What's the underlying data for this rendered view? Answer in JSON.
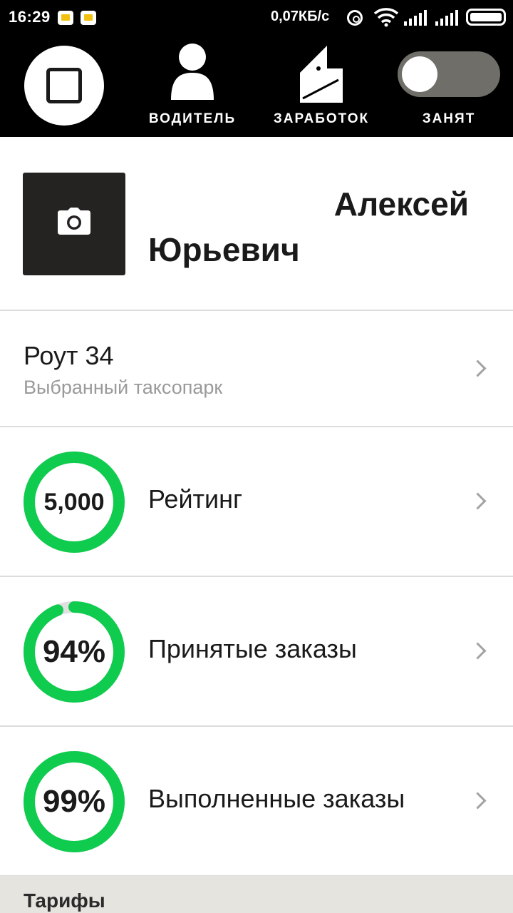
{
  "status_bar": {
    "time": "16:29",
    "speed": "0,07КБ/с",
    "icons": [
      "notification-icon",
      "notification-icon",
      "hotspot-icon",
      "wifi-icon",
      "signal-icon",
      "signal-icon",
      "battery-icon"
    ]
  },
  "toolbar": {
    "driver_label": "ВОДИТЕЛЬ",
    "earnings_label": "ЗАРАБОТОК",
    "busy_label": "ЗАНЯТ",
    "busy_on": false
  },
  "profile": {
    "first_name": "Алексей",
    "middle_name": "Юрьевич"
  },
  "taxi_park": {
    "name": "Роут 34",
    "subtitle": "Выбранный таксопарк"
  },
  "metrics": [
    {
      "value": "5,000",
      "label": "Рейтинг",
      "fraction": 1.0
    },
    {
      "value": "94%",
      "label": "Принятые заказы",
      "fraction": 0.94
    },
    {
      "value": "99%",
      "label": "Выполненные заказы",
      "fraction": 0.99
    }
  ],
  "section": {
    "title": "Тарифы"
  },
  "colors": {
    "accent_green": "#0fcb4e",
    "ring_track": "#e0e0e0",
    "toolbar_bg": "#000000",
    "switch_off": "#6f6e69"
  }
}
